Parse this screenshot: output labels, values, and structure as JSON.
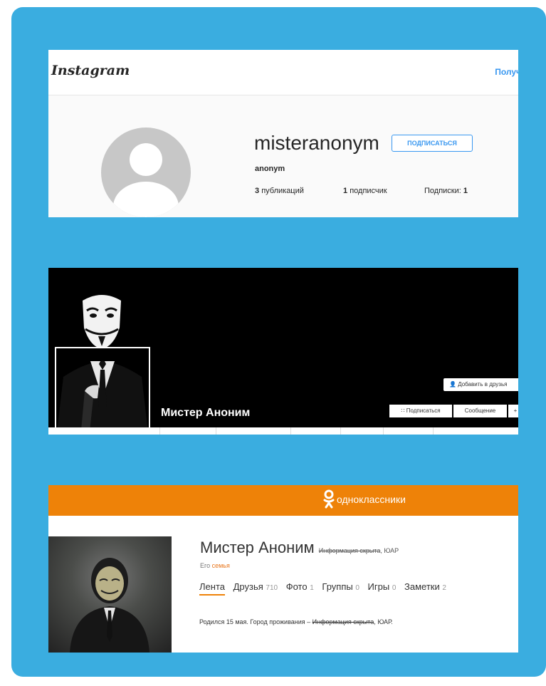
{
  "instagram": {
    "logo": "Instagram",
    "topright": "Получ",
    "username": "misteranonym",
    "follow_button": "ПОДПИСАТЬСЯ",
    "fullname": "anonym",
    "stats": {
      "posts_count": "3",
      "posts_label": "публикаций",
      "followers_count": "1",
      "followers_label": "подписчик",
      "following_label": "Подписки:",
      "following_count": "1"
    }
  },
  "vk": {
    "name": "Мистер Аноним",
    "add_friend": "Добавить в друзья",
    "subscribe": "Подписаться",
    "message": "Сообщение",
    "more": "+"
  },
  "ok": {
    "brand": "одноклассники",
    "name": "Мистер Аноним",
    "location_hidden": "Информация скрыта",
    "location_country": ", ЮАР",
    "family_prefix": "Его",
    "family_link": "семья",
    "nav": [
      {
        "label": "Лента",
        "count": ""
      },
      {
        "label": "Друзья",
        "count": "710"
      },
      {
        "label": "Фото",
        "count": "1"
      },
      {
        "label": "Группы",
        "count": "0"
      },
      {
        "label": "Игры",
        "count": "0"
      },
      {
        "label": "Заметки",
        "count": "2"
      }
    ],
    "born_text": "Родился 15 мая. Город проживания –",
    "born_hidden": "Информация скрыта",
    "born_country": ", ЮАР."
  },
  "colors": {
    "background_frame": "#3aade0",
    "instagram_link": "#3897f0",
    "ok_orange": "#ee8208"
  }
}
